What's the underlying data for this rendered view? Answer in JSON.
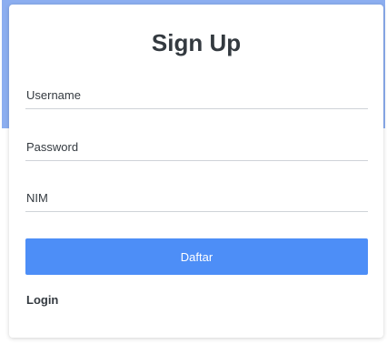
{
  "form": {
    "title": "Sign Up",
    "username": {
      "placeholder": "Username",
      "value": ""
    },
    "password": {
      "placeholder": "Password",
      "value": ""
    },
    "nim": {
      "placeholder": "NIM",
      "value": ""
    },
    "submit_label": "Daftar",
    "login_link_label": "Login"
  },
  "colors": {
    "accent_background": "#8caef0",
    "primary_button": "#4d8ef7",
    "text_dark": "#343a40"
  }
}
